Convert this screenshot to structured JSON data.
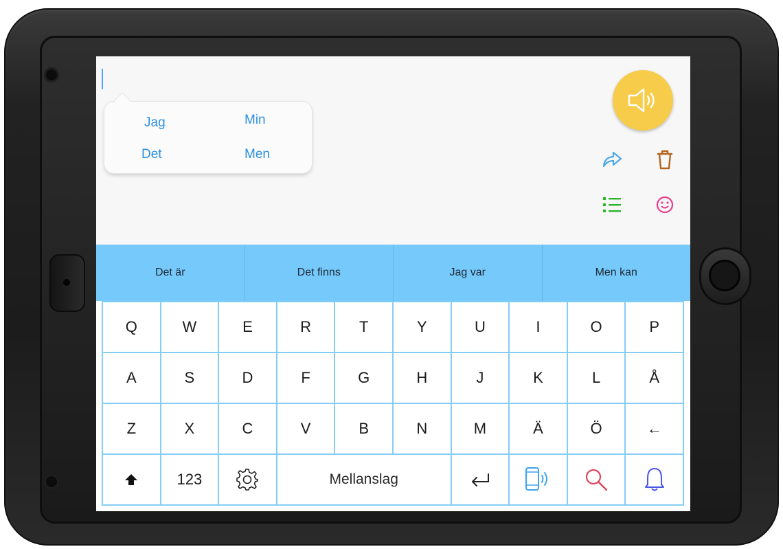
{
  "prediction_popup": {
    "words": [
      "Jag",
      "Min",
      "Det",
      "Men"
    ]
  },
  "actions": {
    "speak_icon": "speaker-icon",
    "speak_color": "#f6cc4a",
    "share_icon": "share-arrow-icon",
    "trash_icon": "trash-icon",
    "list_icon": "list-icon",
    "emoji_icon": "smiley-icon"
  },
  "phrase_bar": {
    "phrases": [
      "Det är",
      "Det finns",
      "Jag var",
      "Men kan"
    ],
    "color": "#76c9fb"
  },
  "keyboard": {
    "rows": [
      [
        "Q",
        "W",
        "E",
        "R",
        "T",
        "Y",
        "U",
        "I",
        "O",
        "P"
      ],
      [
        "A",
        "S",
        "D",
        "F",
        "G",
        "H",
        "J",
        "K",
        "L",
        "Å"
      ],
      [
        "Z",
        "X",
        "C",
        "V",
        "B",
        "N",
        "M",
        "Ä",
        "Ö",
        "←"
      ]
    ],
    "bottom": {
      "shift_icon": "shift-arrow-icon",
      "numbers_label": "123",
      "settings_icon": "gear-icon",
      "space_label": "Mellanslag",
      "return_icon": "return-icon",
      "speak_phone_icon": "phone-speak-icon",
      "search_icon": "search-icon",
      "bell_icon": "bell-icon"
    },
    "grid_color": "#86cdf6"
  }
}
